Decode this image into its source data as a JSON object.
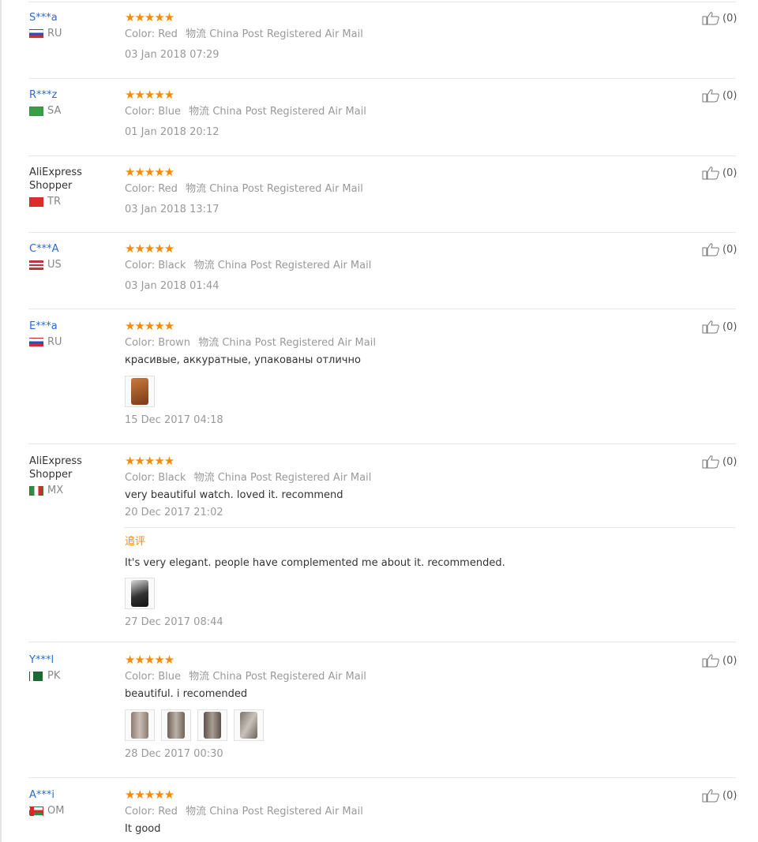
{
  "reviews": [
    {
      "user": "S***a",
      "country": "RU",
      "rating": "★★★★★",
      "color_label": "Color:",
      "color": "Red",
      "logistics_label": "物流",
      "logistics": "China Post Registered Air Mail",
      "date": "03 Jan 2018 07:29",
      "likes": "(0)"
    },
    {
      "user": "R***z",
      "country": "SA",
      "rating": "★★★★★",
      "color_label": "Color:",
      "color": "Blue",
      "logistics_label": "物流",
      "logistics": "China Post Registered Air Mail",
      "date": "01 Jan 2018 20:12",
      "likes": "(0)"
    },
    {
      "user": "AliExpress Shopper",
      "country": "TR",
      "rating": "★★★★★",
      "color_label": "Color:",
      "color": "Red",
      "logistics_label": "物流",
      "logistics": "China Post Registered Air Mail",
      "date": "03 Jan 2018 13:17",
      "likes": "(0)"
    },
    {
      "user": "C***A",
      "country": "US",
      "rating": "★★★★★",
      "color_label": "Color:",
      "color": "Black",
      "logistics_label": "物流",
      "logistics": "China Post Registered Air Mail",
      "date": "03 Jan 2018 01:44",
      "likes": "(0)"
    },
    {
      "user": "E***a",
      "country": "RU",
      "rating": "★★★★★",
      "color_label": "Color:",
      "color": "Brown",
      "logistics_label": "物流",
      "logistics": "China Post Registered Air Mail",
      "comment": "красивые, аккуратные, упакованы отлично",
      "date": "15 Dec 2017 04:18",
      "likes": "(0)"
    },
    {
      "user": "AliExpress Shopper",
      "country": "MX",
      "rating": "★★★★★",
      "color_label": "Color:",
      "color": "Black",
      "logistics_label": "物流",
      "logistics": "China Post Registered Air Mail",
      "comment": "very beautiful watch. loved it. recommend",
      "date": "20 Dec 2017 21:02",
      "likes": "(0)",
      "followup_title": "追评",
      "followup_comment": "It's very elegant. people have complemented me about it. recommended.",
      "followup_date": "27 Dec 2017 08:44"
    },
    {
      "user": "Y***l",
      "country": "PK",
      "rating": "★★★★★",
      "color_label": "Color:",
      "color": "Blue",
      "logistics_label": "物流",
      "logistics": "China Post Registered Air Mail",
      "comment": "beautiful. i recomended",
      "date": "28 Dec 2017 00:30",
      "likes": "(0)"
    },
    {
      "user": "A***i",
      "country": "OM",
      "rating": "★★★★★",
      "color_label": "Color:",
      "color": "Red",
      "logistics_label": "物流",
      "logistics": "China Post Registered Air Mail",
      "comment": "It good",
      "likes": "(0)"
    }
  ],
  "colors": {
    "star": "#f78b07",
    "username": "#2a6bd1",
    "followup": "#f78b07"
  },
  "icons": {
    "like": "thumbs-up-icon",
    "rating": "star-icon"
  }
}
